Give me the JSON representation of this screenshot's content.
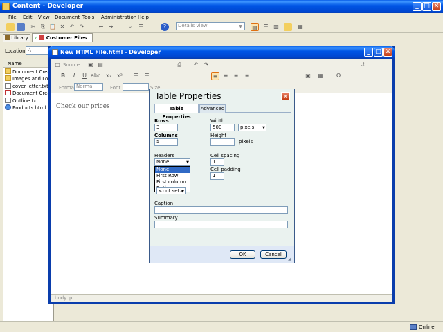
{
  "app": {
    "title": "Content - Developer",
    "menu": [
      "File",
      "Edit",
      "View",
      "Document",
      "Tools",
      "Administration",
      "Help"
    ],
    "view_select": "Details view",
    "tabs": [
      {
        "label": "Library"
      },
      {
        "label": "Customer Files"
      }
    ],
    "location_label": "Location:",
    "location_value": ".\\",
    "column_name": "Name",
    "files": [
      {
        "name": "Document Creati",
        "icon": "folder-icon"
      },
      {
        "name": "Images and Logo",
        "icon": "folder-icon"
      },
      {
        "name": "cover letter.txt",
        "icon": "text-file-icon"
      },
      {
        "name": "Document Creati",
        "icon": "document-icon"
      },
      {
        "name": "Outline.txt",
        "icon": "text-file-icon"
      },
      {
        "name": "Products.html",
        "icon": "html-file-icon"
      }
    ],
    "status_online": "Online"
  },
  "editor": {
    "title": "New HTML File.html - Developer",
    "source_label": "Source",
    "format_label": "Format",
    "format_value": "Normal",
    "font_label": "Font",
    "size_label": "Size",
    "content_text": "Check our prices",
    "path": [
      "body",
      "p"
    ]
  },
  "dialog": {
    "title": "Table Properties",
    "tabs": [
      "Table Properties",
      "Advanced"
    ],
    "rows_label": "Rows",
    "rows_value": "3",
    "columns_label": "Columns",
    "columns_value": "5",
    "width_label": "Width",
    "width_value": "500",
    "width_unit": "pixels",
    "height_label": "Height",
    "height_value": "",
    "height_unit": "pixels",
    "headers_label": "Headers",
    "headers_value": "None",
    "headers_options": [
      "None",
      "First Row",
      "First column",
      "Both"
    ],
    "hidden_select_value": "<not set>",
    "cell_spacing_label": "Cell spacing",
    "cell_spacing_value": "1",
    "cell_padding_label": "Cell padding",
    "cell_padding_value": "1",
    "caption_label": "Caption",
    "caption_value": "",
    "summary_label": "Summary",
    "summary_value": "",
    "ok_label": "OK",
    "cancel_label": "Cancel"
  }
}
